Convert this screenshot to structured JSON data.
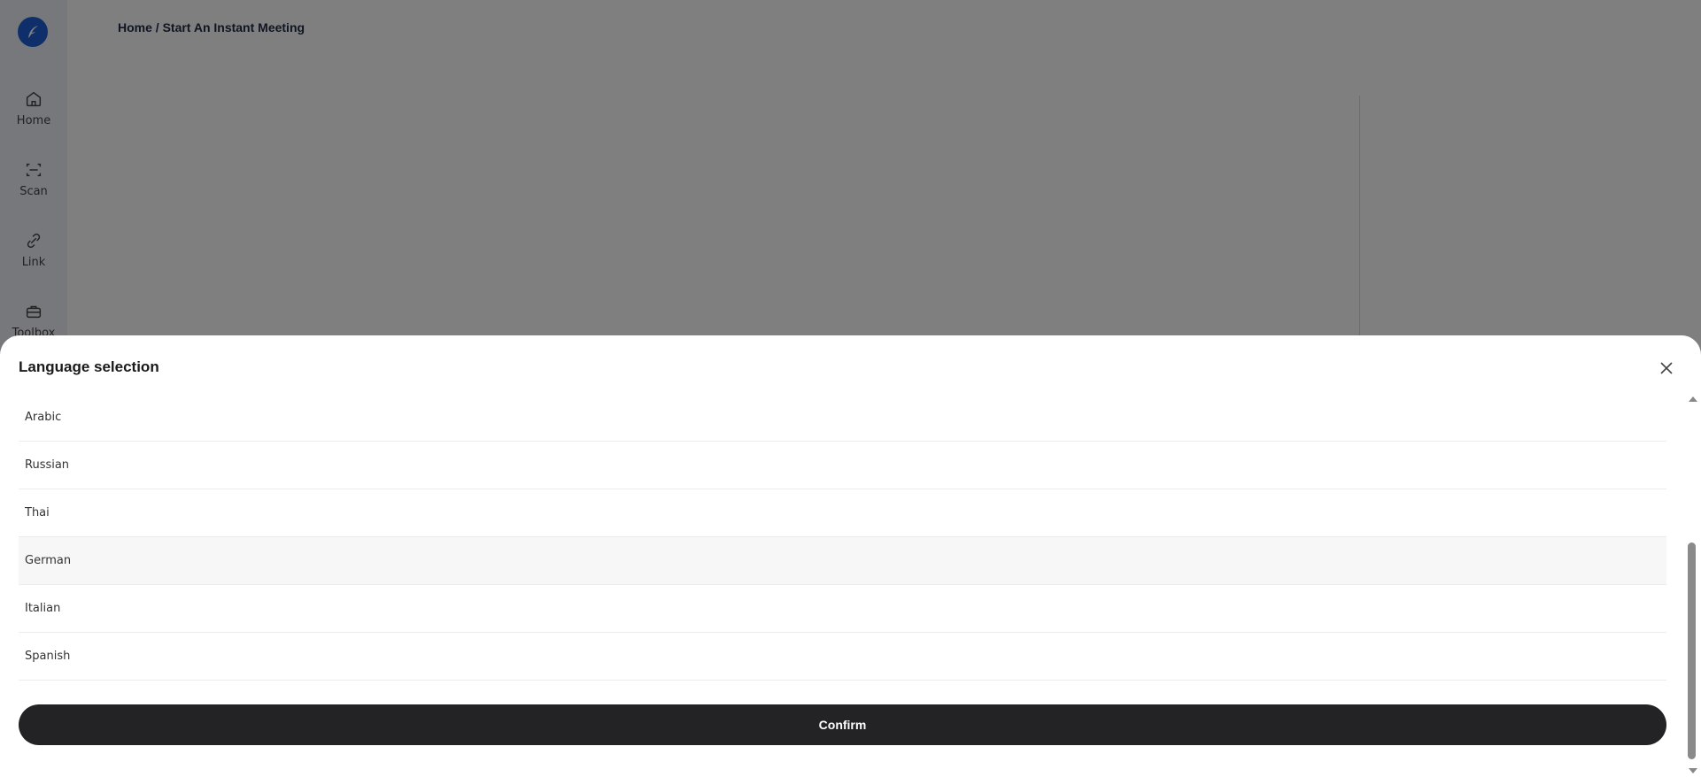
{
  "app": {
    "breadcrumb": "Home / Start An Instant Meeting",
    "nav": [
      {
        "label": "Home",
        "icon": "home-icon"
      },
      {
        "label": "Scan",
        "icon": "scan-icon"
      },
      {
        "label": "Link",
        "icon": "link-icon"
      },
      {
        "label": "Toolbox",
        "icon": "toolbox-icon"
      }
    ],
    "colors": {
      "brand": "#1f5fd6",
      "sidebar": "#eef0f8"
    }
  },
  "sheet": {
    "title": "Language selection",
    "close_icon": "close-icon",
    "languages": [
      "Arabic",
      "Russian",
      "Thai",
      "German",
      "Italian",
      "Spanish"
    ],
    "hovered": "German",
    "confirm_label": "Confirm",
    "colors": {
      "confirm_bg": "#232325",
      "confirm_text": "#ffffff"
    }
  }
}
